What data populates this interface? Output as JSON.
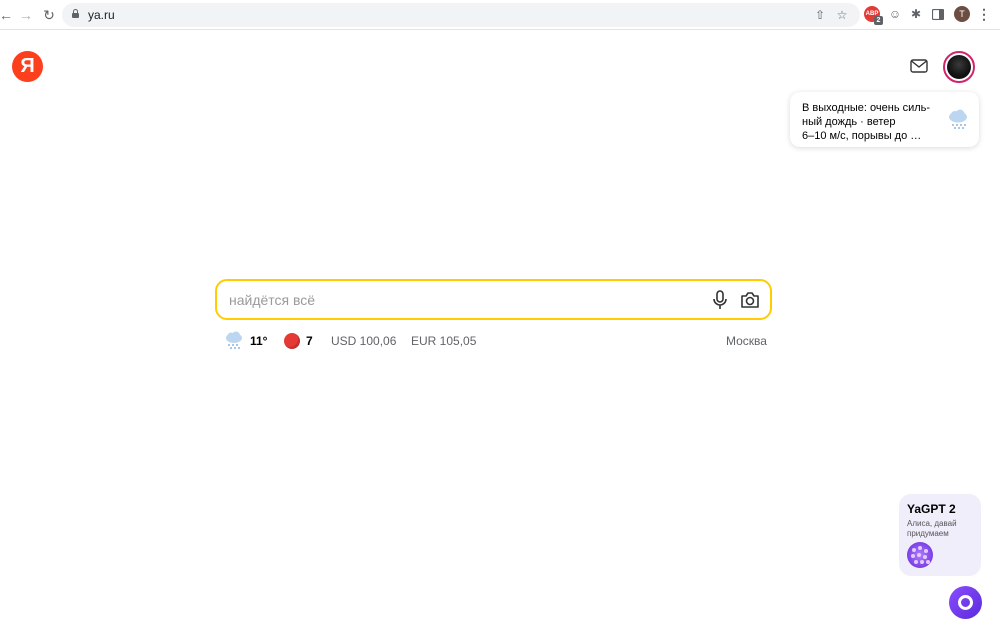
{
  "browser": {
    "url": "ya.ru",
    "extension_badge": "2",
    "extension_label": "ABP",
    "profile_initial": "T"
  },
  "header": {
    "logo_letter": "Я"
  },
  "weather_card": {
    "lines": [
      "В выходные: очень силь-",
      "ный дождь · ветер",
      "6–10 м/с, порывы до …"
    ]
  },
  "search": {
    "placeholder": "найдётся всё",
    "value": ""
  },
  "info_row": {
    "temperature": "11°",
    "traffic": "7",
    "usd": "USD 100,06",
    "eur": "EUR 105,05",
    "city": "Москва"
  },
  "yagpt": {
    "title": "YaGPT 2",
    "subtitle": "Алиса, давай придумаем"
  },
  "colors": {
    "brand_red": "#fc3f1d",
    "search_border": "#ffcc00",
    "alice_purple": "#7b3fe4"
  }
}
